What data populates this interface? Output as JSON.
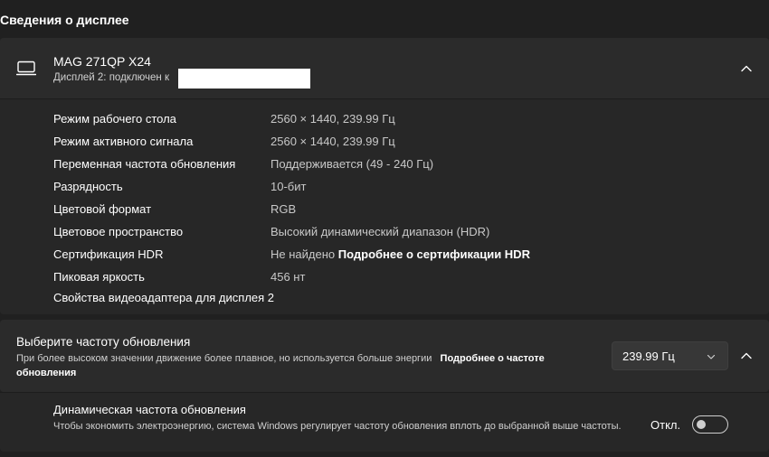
{
  "section_title": "Сведения о дисплее",
  "display": {
    "name": "MAG 271QP X24",
    "subtitle": "Дисплей 2: подключен к",
    "icon": "monitor-icon",
    "properties": [
      {
        "label": "Режим рабочего стола",
        "value": "2560 × 1440, 239.99 Гц"
      },
      {
        "label": "Режим активного сигнала",
        "value": "2560 × 1440, 239.99 Гц"
      },
      {
        "label": "Переменная частота обновления",
        "value": "Поддерживается (49 - 240 Гц)"
      },
      {
        "label": "Разрядность",
        "value": "10-бит"
      },
      {
        "label": "Цветовой формат",
        "value": "RGB"
      },
      {
        "label": "Цветовое пространство",
        "value": "Высокий динамический диапазон (HDR)"
      },
      {
        "label": "Сертификация HDR",
        "value": "Не найдено",
        "link": "Подробнее о сертификации HDR"
      },
      {
        "label": "Пиковая яркость",
        "value": "456 нт"
      }
    ],
    "adapter_link": "Свойства видеоадаптера для дисплея 2"
  },
  "refresh": {
    "title": "Выберите частоту обновления",
    "description": "При более высоком значении движение более плавное, но используется больше энергии",
    "link": "Подробнее о частоте обновления",
    "selected_rate": "239.99 Гц"
  },
  "dynamic": {
    "title": "Динамическая частота обновления",
    "description": "Чтобы экономить электроэнергию, система Windows регулирует частоту обновления вплоть до выбранной выше частоты.",
    "toggle_label": "Откл.",
    "toggle_on": false
  },
  "colors": {
    "background": "#202020",
    "card": "#2b2b2b",
    "card_inner": "#272727",
    "text": "#ffffff",
    "muted": "#c8c8c8"
  }
}
